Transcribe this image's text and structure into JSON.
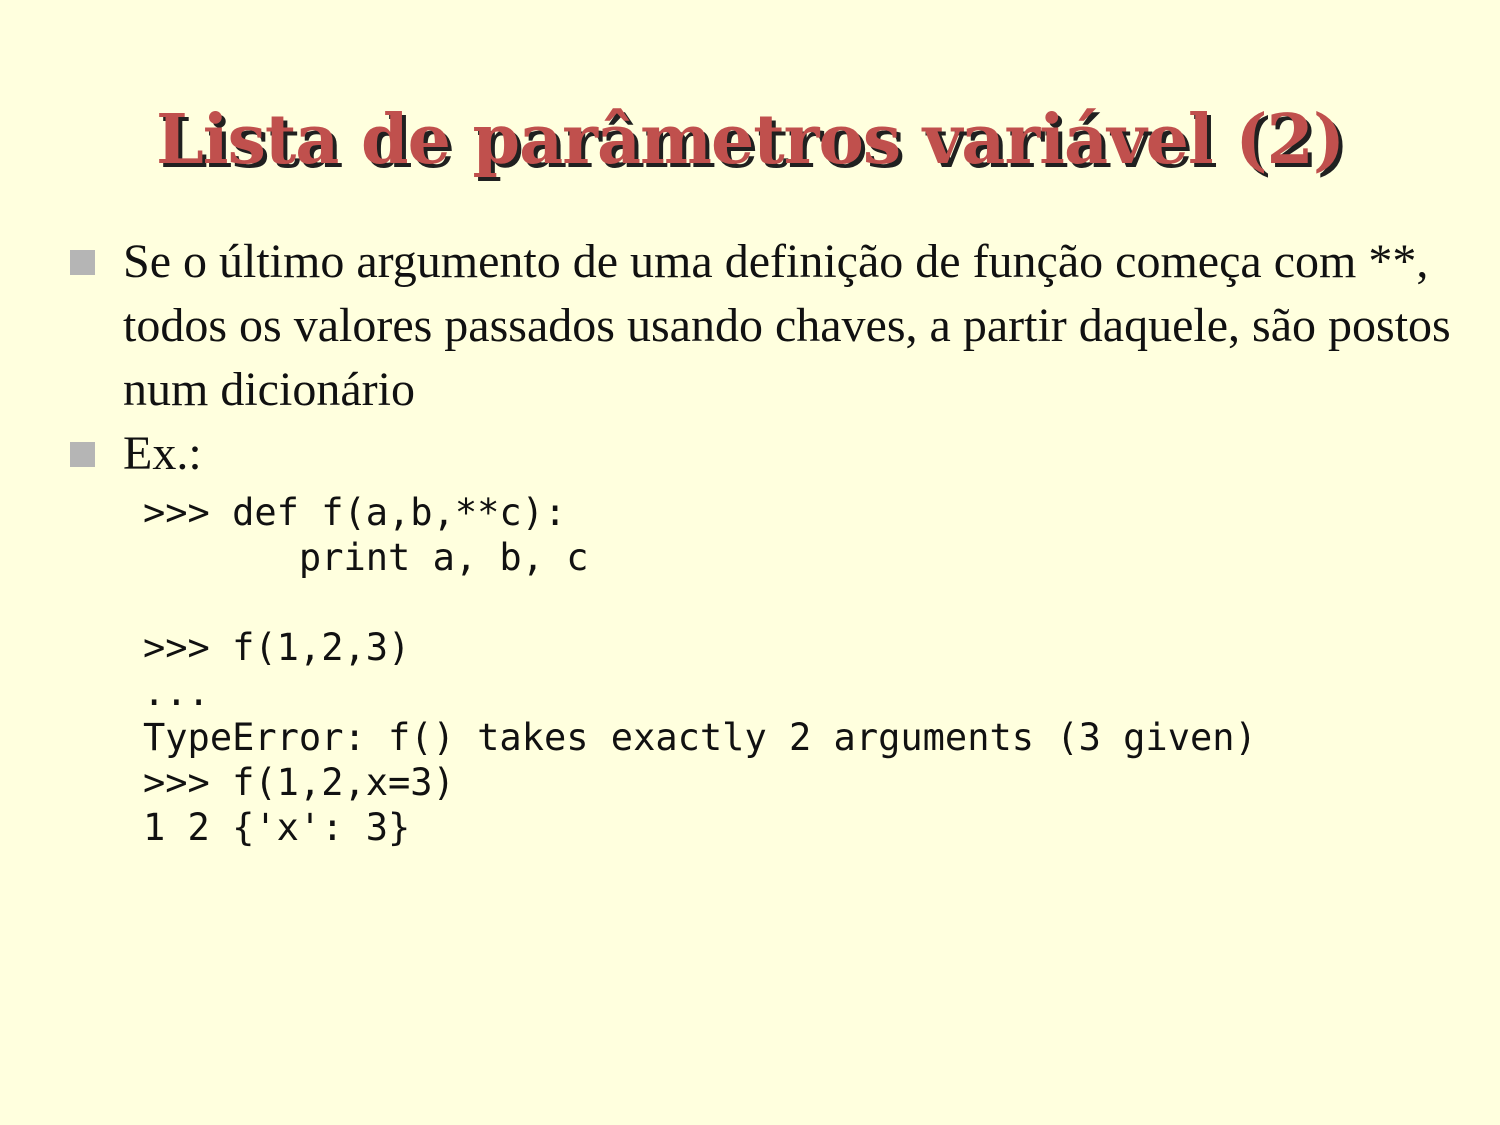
{
  "slide": {
    "title": "Lista de parâmetros variável (2)",
    "bullets": [
      {
        "marker_icon": "square-bullet-icon",
        "text": "Se o último argumento de uma definição de função começa com **, todos os valores passados usando chaves, a partir daquele, são postos num dicionário"
      },
      {
        "marker_icon": "square-bullet-icon",
        "text": "Ex.:"
      }
    ],
    "code_lines": [
      ">>> def f(a,b,**c):",
      "       print a, b, c",
      "",
      ">>> f(1,2,3)",
      "...",
      "TypeError: f() takes exactly 2 arguments (3 given)",
      ">>> f(1,2,x=3)",
      "1 2 {'x': 3}"
    ],
    "colors": {
      "background": "#ffffde",
      "title": "#c0504d",
      "title_shadow": "#202020",
      "bullet_marker": "#b5b5b5",
      "text": "#111111"
    }
  }
}
